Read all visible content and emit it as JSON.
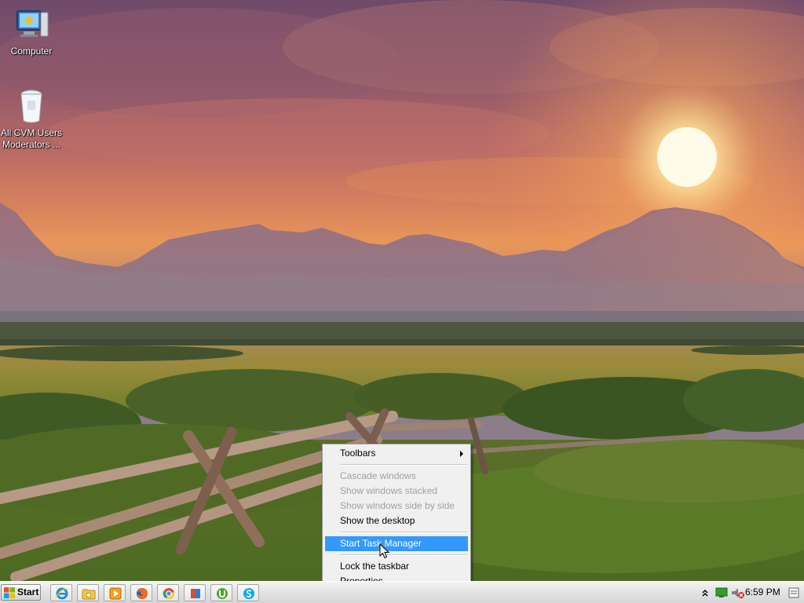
{
  "desktop": {
    "icons": [
      {
        "label": "Computer",
        "icon": "computer-icon"
      },
      {
        "label": "All CVM Users Moderators ...",
        "icon": "recycle-bin-icon"
      }
    ]
  },
  "context_menu": {
    "items": [
      {
        "label": "Toolbars",
        "enabled": true,
        "has_submenu": true
      },
      {
        "label": "Cascade windows",
        "enabled": false
      },
      {
        "label": "Show windows stacked",
        "enabled": false
      },
      {
        "label": "Show windows side by side",
        "enabled": false
      },
      {
        "label": "Show the desktop",
        "enabled": true
      },
      {
        "label": "Start Task Manager",
        "enabled": true,
        "highlighted": true
      },
      {
        "label": "Lock the taskbar",
        "enabled": true
      },
      {
        "label": "Properties",
        "enabled": true
      }
    ]
  },
  "taskbar": {
    "start_label": "Start",
    "pinned": [
      {
        "icon": "internet-explorer-icon"
      },
      {
        "icon": "file-explorer-icon"
      },
      {
        "icon": "media-player-icon"
      },
      {
        "icon": "firefox-icon"
      },
      {
        "icon": "chrome-icon"
      },
      {
        "icon": "store-icon"
      },
      {
        "icon": "utorrent-icon"
      },
      {
        "icon": "skype-icon"
      }
    ],
    "tray": {
      "clock": "6:59 PM",
      "icons": [
        "show-hidden-icons-chevron",
        "network-icon",
        "volume-muted-icon",
        "action-center-icon"
      ]
    }
  },
  "colors": {
    "menu_highlight": "#3399ff",
    "menu_background": "#f0f0f0",
    "taskbar": "#e2e2e2"
  }
}
